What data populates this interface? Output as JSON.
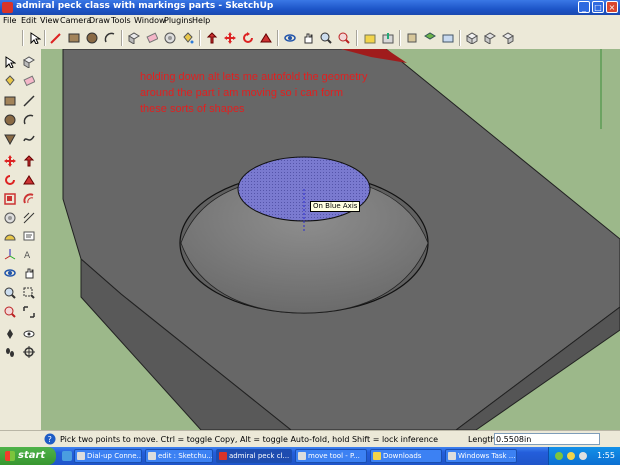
{
  "window": {
    "title": "admiral peck class with markings parts - SketchUp",
    "min_glyph": "_",
    "max_glyph": "□",
    "close_glyph": "×"
  },
  "menu": [
    "File",
    "Edit",
    "View",
    "Camera",
    "Draw",
    "Tools",
    "Window",
    "Plugins",
    "Help"
  ],
  "toolbar_icons": [
    "select-icon",
    "pencil-icon",
    "line-icon",
    "rectangle-icon",
    "circle-icon",
    "arc-icon",
    "make-component-icon",
    "eraser-icon",
    "tape-measure-icon",
    "paint-bucket-icon",
    "push-pull-icon",
    "move-icon",
    "rotate-icon",
    "follow-me-icon",
    "scale-icon",
    "orbit-icon",
    "pan-icon",
    "zoom-icon",
    "zoom-window-icon",
    "zoom-extents-icon",
    "get-models-icon",
    "share-model-icon",
    "component-icon",
    "place-model-icon",
    "get-photo-icon",
    "section-plane-icon",
    "iso-view-icon",
    "top-view-icon",
    "front-view-icon",
    "right-view-icon"
  ],
  "palette_icons": [
    "select-icon",
    "make-component-icon",
    "paint-bucket-icon",
    "eraser-icon",
    "rectangle-icon",
    "line-icon",
    "circle-icon",
    "arc-icon",
    "polygon-icon",
    "freehand-icon",
    "move-icon",
    "push-pull-icon",
    "rotate-icon",
    "follow-me-icon",
    "scale-icon",
    "offset-icon",
    "tape-measure-icon",
    "dimension-icon",
    "protractor-icon",
    "text-icon",
    "axes-icon",
    "3d-text-icon",
    "orbit-icon",
    "pan-icon",
    "zoom-icon",
    "zoom-window-icon",
    "previous-icon",
    "zoom-extents-icon",
    "position-camera-icon",
    "look-around-icon",
    "walk-icon",
    "section-plane-icon"
  ],
  "viewport": {
    "annotation_lines": [
      "holding down alt lets me autofold the geometry",
      "around the part i am moving so i can form",
      "these sorts of shapes"
    ],
    "inference_tooltip": "On Blue Axis"
  },
  "status": {
    "hint": "Pick two points to move.  Ctrl = toggle Copy, Alt = toggle Auto-fold, hold Shift = lock inference",
    "length_label": "Length",
    "length_value": "0.5508in"
  },
  "taskbar": {
    "start_label": "start",
    "tasks": [
      {
        "label": "Dial-up Conne...",
        "active": false
      },
      {
        "label": "edit : Sketchu...",
        "active": false
      },
      {
        "label": "admiral peck cl...",
        "active": true
      },
      {
        "label": "move tool - P...",
        "active": false
      },
      {
        "label": "Downloads",
        "active": false
      },
      {
        "label": "Windows Task ...",
        "active": false
      }
    ],
    "clock": "1:55"
  },
  "colors": {
    "sky_ground": "#9cb88a",
    "surface": "#5f5f5f",
    "selection": "#6a6ab8",
    "annotation": "#e02020"
  }
}
